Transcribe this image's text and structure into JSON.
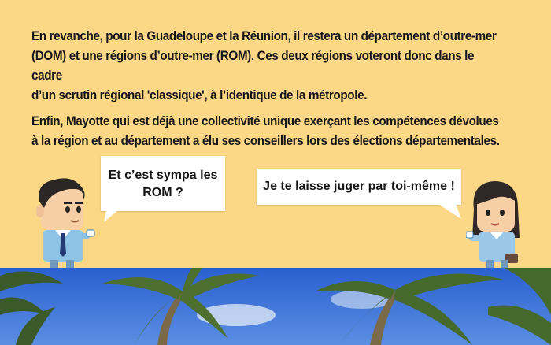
{
  "paragraphs": {
    "p1": [
      "En revanche, pour la Guadeloupe et la Réunion, il restera un département d’outre-mer",
      "(DOM) et une régions d’outre-mer (ROM). Ces deux régions voteront donc dans le cadre",
      "d’un scrutin régional 'classique', à l’identique de la métropole."
    ],
    "p2": [
      "Enfin, Mayotte qui est déjà une collectivité unique exerçant les compétences dévolues",
      "à la région et au département a élu ses conseillers lors des élections départementales."
    ]
  },
  "bubbles": {
    "left": [
      "Et c’est sympa les",
      "ROM ?"
    ],
    "right": "Je te laisse juger par toi-même !"
  },
  "colors": {
    "background": "#fcd785",
    "text": "#15151a",
    "sky": "#3a6fd8"
  }
}
